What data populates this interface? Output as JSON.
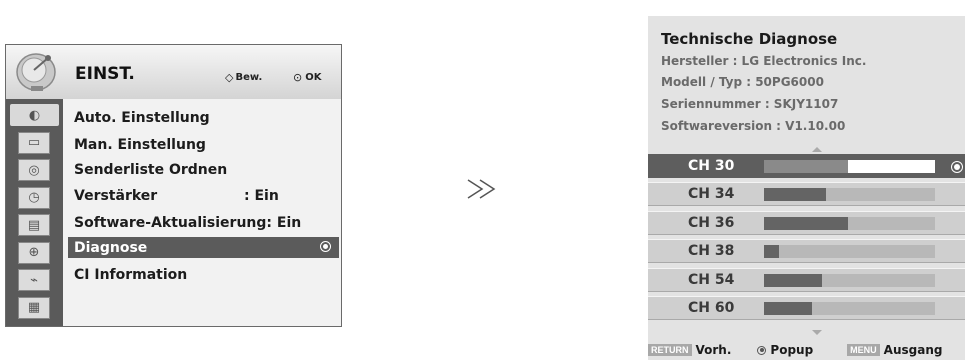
{
  "menu": {
    "title": "EINST.",
    "hint_move": "Bew.",
    "hint_ok": "OK",
    "categories": [
      {
        "icon": "picture-icon"
      },
      {
        "icon": "screen-icon"
      },
      {
        "icon": "audio-icon"
      },
      {
        "icon": "clock-icon"
      },
      {
        "icon": "option-icon"
      },
      {
        "icon": "lock-icon"
      },
      {
        "icon": "input-icon"
      },
      {
        "icon": "usb-icon"
      }
    ],
    "items": [
      {
        "label": "Auto. Einstellung"
      },
      {
        "label": "Man. Einstellung"
      },
      {
        "label": "Senderliste Ordnen"
      },
      {
        "label": "Verstärker",
        "value": ": Ein"
      },
      {
        "label": "Software-Aktualisierung: Ein"
      },
      {
        "label": "Diagnose",
        "selected": true
      },
      {
        "label": "CI Information"
      }
    ]
  },
  "arrow": "≫",
  "diagnostics": {
    "title": "Technische Diagnose",
    "manufacturer": "Hersteller : LG Electronics Inc.",
    "model": "Modell / Typ : 50PG6000",
    "serial": "Seriennummer : SKJY1107",
    "software": "Softwareversion : V1.10.00",
    "channels": [
      {
        "label": "CH 30",
        "signal": 0.49,
        "selected": true
      },
      {
        "label": "CH 34",
        "signal": 0.36
      },
      {
        "label": "CH 36",
        "signal": 0.49
      },
      {
        "label": "CH 38",
        "signal": 0.09
      },
      {
        "label": "CH 54",
        "signal": 0.34
      },
      {
        "label": "CH 60",
        "signal": 0.28
      }
    ],
    "footer": {
      "return_key": "RETURN",
      "return_label": "Vorh.",
      "popup_label": "Popup",
      "menu_key": "MENU",
      "menu_label": "Ausgang"
    }
  },
  "colors": {
    "panel_bg": "#f2f2f2",
    "selection": "#5b5b5b",
    "diag_bg": "#e3e3e3"
  }
}
